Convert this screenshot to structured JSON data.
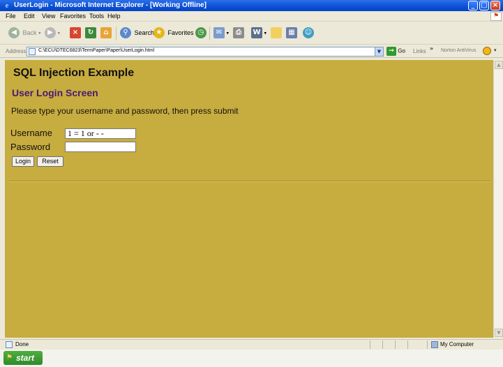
{
  "window": {
    "title": "UserLogin - Microsoft Internet Explorer - [Working Offline]",
    "icon": "ie-icon",
    "controls": [
      "minimize",
      "maximize",
      "close"
    ]
  },
  "menu": {
    "items": [
      "File",
      "Edit",
      "View",
      "Favorites",
      "Tools",
      "Help"
    ]
  },
  "toolbar": {
    "back_label": "Back",
    "search_label": "Search",
    "favorites_label": "Favorites"
  },
  "address": {
    "label": "Address",
    "url": "C:\\ECU\\DTEC6823\\TermPaper\\Paper\\UserLogin.html",
    "go_label": "Go",
    "links_label": "Links",
    "norton_label": "Norton AntiVirus"
  },
  "page": {
    "heading": "SQL Injection Example",
    "subheading": "User Login Screen",
    "instructions": "Please type your username and password, then press submit",
    "username_label": "Username",
    "username_value": "1 = 1 or - -",
    "password_label": "Password",
    "password_value": "",
    "login_button": "Login",
    "reset_button": "Reset"
  },
  "status": {
    "text": "Done",
    "zone": "My Computer"
  },
  "taskbar": {
    "start_label": "start"
  },
  "colors": {
    "page_background": "#c7ac3f",
    "subheading": "#4a1a74",
    "titlebar": "#0a4fd6",
    "start_button": "#3a9a33"
  }
}
